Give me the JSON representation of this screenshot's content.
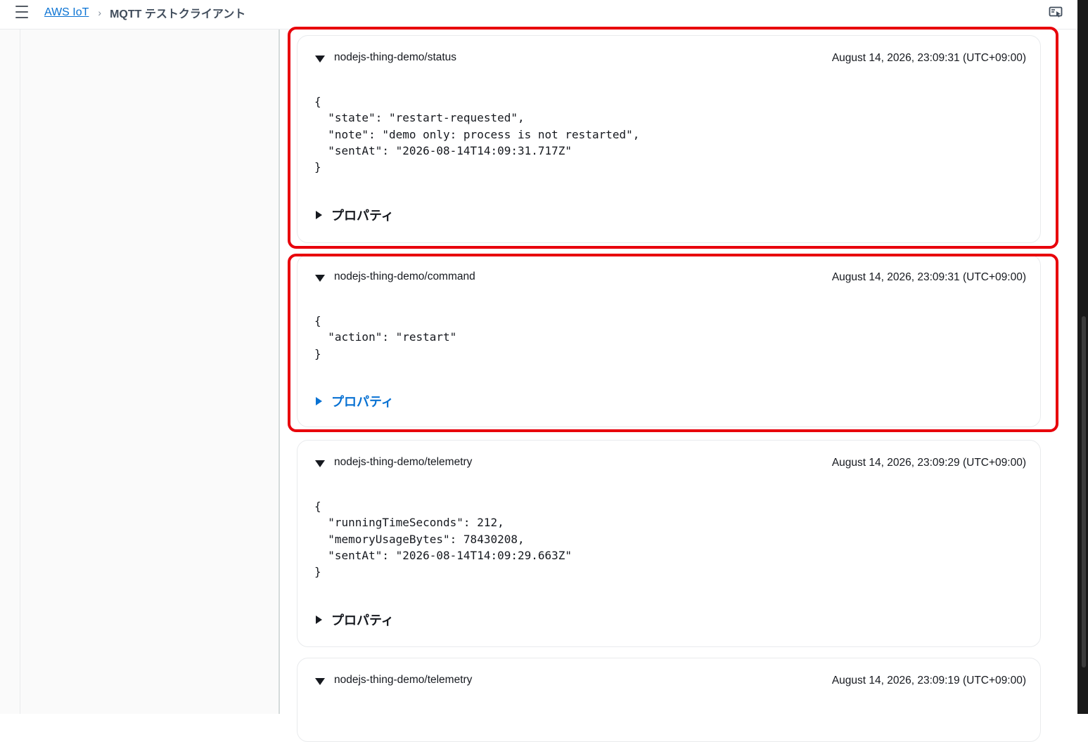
{
  "header": {
    "breadcrumb": {
      "root": "AWS IoT",
      "separator": "›",
      "current": "MQTT テストクライアント"
    },
    "menu_icon": "hamburger-menu-icon",
    "panel_icon": "split-panel-icon"
  },
  "messages": [
    {
      "topic": "nodejs-thing-demo/status",
      "timestamp": "August 14, 2026, 23:09:31 (UTC+09:00)",
      "payload": "{\n  \"state\": \"restart-requested\",\n  \"note\": \"demo only: process is not restarted\",\n  \"sentAt\": \"2026-08-14T14:09:31.717Z\"\n}",
      "properties_label": "プロパティ",
      "highlighted": true
    },
    {
      "topic": "nodejs-thing-demo/command",
      "timestamp": "August 14, 2026, 23:09:31 (UTC+09:00)",
      "payload": "{\n  \"action\": \"restart\"\n}",
      "properties_label": "プロパティ",
      "highlighted": true,
      "properties_focused": true
    },
    {
      "topic": "nodejs-thing-demo/telemetry",
      "timestamp": "August 14, 2026, 23:09:29 (UTC+09:00)",
      "payload": "{\n  \"runningTimeSeconds\": 212,\n  \"memoryUsageBytes\": 78430208,\n  \"sentAt\": \"2026-08-14T14:09:29.663Z\"\n}",
      "properties_label": "プロパティ",
      "highlighted": false
    },
    {
      "topic": "nodejs-thing-demo/telemetry",
      "timestamp": "August 14, 2026, 23:09:19 (UTC+09:00)",
      "highlighted": false
    }
  ],
  "colors": {
    "link": "#0972d3",
    "highlight": "#e8000b",
    "text": "#16191f"
  }
}
